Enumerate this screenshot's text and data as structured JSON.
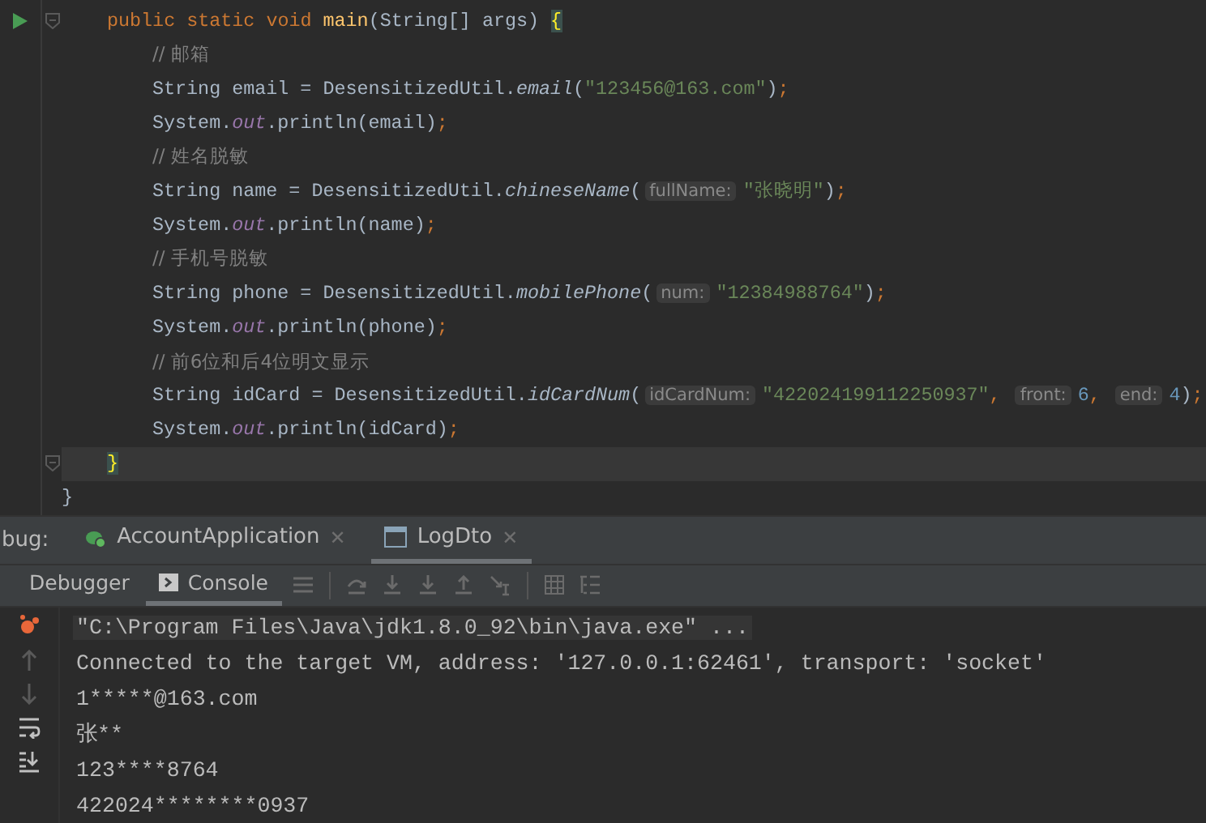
{
  "editor": {
    "lines": [
      {
        "tokens": [
          {
            "t": "public static void ",
            "kind": "kw"
          },
          {
            "t": "main",
            "kind": "decl"
          },
          {
            "t": "(String[] args) ",
            "kind": "plain"
          },
          {
            "t": "{",
            "kind": "brace"
          }
        ],
        "runnable": true,
        "current": false,
        "children": [
          {
            "tokens": [
              {
                "t": "// 邮箱",
                "kind": "comment"
              }
            ]
          },
          {
            "tokens": [
              {
                "t": "String email = DesensitizedUtil.",
                "kind": "plain"
              },
              {
                "t": "email",
                "kind": "call"
              },
              {
                "t": "(",
                "kind": "plain"
              },
              {
                "t": "\"123456@163.com\"",
                "kind": "str"
              },
              {
                "t": ")",
                "kind": "plain"
              },
              {
                "t": ";",
                "kind": "semi"
              }
            ]
          },
          {
            "tokens": [
              {
                "t": "System.",
                "kind": "plain"
              },
              {
                "t": "out",
                "kind": "field"
              },
              {
                "t": ".println(email)",
                "kind": "plain"
              },
              {
                "t": ";",
                "kind": "semi"
              }
            ]
          },
          {
            "tokens": [
              {
                "t": "// 姓名脱敏",
                "kind": "comment"
              }
            ]
          },
          {
            "tokens": [
              {
                "t": "String name = DesensitizedUtil.",
                "kind": "plain"
              },
              {
                "t": "chineseName",
                "kind": "call"
              },
              {
                "t": "(",
                "kind": "plain"
              },
              {
                "t": "fullName:",
                "kind": "hint"
              },
              {
                "t": "\"张晓明\"",
                "kind": "str"
              },
              {
                "t": ")",
                "kind": "plain"
              },
              {
                "t": ";",
                "kind": "semi"
              }
            ]
          },
          {
            "tokens": [
              {
                "t": "System.",
                "kind": "plain"
              },
              {
                "t": "out",
                "kind": "field"
              },
              {
                "t": ".println(name)",
                "kind": "plain"
              },
              {
                "t": ";",
                "kind": "semi"
              }
            ]
          },
          {
            "tokens": [
              {
                "t": "// 手机号脱敏",
                "kind": "comment"
              }
            ]
          },
          {
            "tokens": [
              {
                "t": "String phone = DesensitizedUtil.",
                "kind": "plain"
              },
              {
                "t": "mobilePhone",
                "kind": "call"
              },
              {
                "t": "(",
                "kind": "plain"
              },
              {
                "t": "num:",
                "kind": "hint"
              },
              {
                "t": "\"12384988764\"",
                "kind": "str"
              },
              {
                "t": ")",
                "kind": "plain"
              },
              {
                "t": ";",
                "kind": "semi"
              }
            ]
          },
          {
            "tokens": [
              {
                "t": "System.",
                "kind": "plain"
              },
              {
                "t": "out",
                "kind": "field"
              },
              {
                "t": ".println(phone)",
                "kind": "plain"
              },
              {
                "t": ";",
                "kind": "semi"
              }
            ]
          },
          {
            "tokens": [
              {
                "t": "// 前6位和后4位明文显示",
                "kind": "comment"
              }
            ]
          },
          {
            "tokens": [
              {
                "t": "String idCard = DesensitizedUtil.",
                "kind": "plain"
              },
              {
                "t": "idCardNum",
                "kind": "call"
              },
              {
                "t": "(",
                "kind": "plain"
              },
              {
                "t": "idCardNum:",
                "kind": "hint"
              },
              {
                "t": "\"422024199112250937\"",
                "kind": "str"
              },
              {
                "t": ", ",
                "kind": "semi"
              },
              {
                "t": "front:",
                "kind": "hint"
              },
              {
                "t": "6",
                "kind": "num"
              },
              {
                "t": ", ",
                "kind": "semi"
              },
              {
                "t": "end:",
                "kind": "hint"
              },
              {
                "t": "4",
                "kind": "num"
              },
              {
                "t": ")",
                "kind": "plain"
              },
              {
                "t": ";",
                "kind": "semi"
              }
            ]
          },
          {
            "tokens": [
              {
                "t": "System.",
                "kind": "plain"
              },
              {
                "t": "out",
                "kind": "field"
              },
              {
                "t": ".println(idCard)",
                "kind": "plain"
              },
              {
                "t": ";",
                "kind": "semi"
              }
            ]
          }
        ]
      },
      {
        "tokens": [
          {
            "t": "}",
            "kind": "brace"
          }
        ],
        "runnable": false,
        "current": true
      }
    ],
    "class_close": "}"
  },
  "debug_panel": {
    "label": "bug:",
    "tabs": [
      {
        "label": "AccountApplication",
        "selected": false,
        "close": "✕"
      },
      {
        "label": "LogDto",
        "selected": true,
        "close": "✕"
      }
    ],
    "views": [
      {
        "label": "Debugger",
        "selected": false
      },
      {
        "label": "Console",
        "selected": true
      }
    ],
    "console": [
      {
        "text": "\"C:\\Program Files\\Java\\jdk1.8.0_92\\bin\\java.exe\" ...",
        "kind": "command"
      },
      {
        "text": "Connected to the target VM, address: '127.0.0.1:62461', transport: 'socket'",
        "kind": "output"
      },
      {
        "text": "1*****@163.com",
        "kind": "output"
      },
      {
        "text": "张**",
        "kind": "output"
      },
      {
        "text": "123****8764",
        "kind": "output"
      },
      {
        "text": "422024********0937",
        "kind": "output"
      }
    ]
  }
}
